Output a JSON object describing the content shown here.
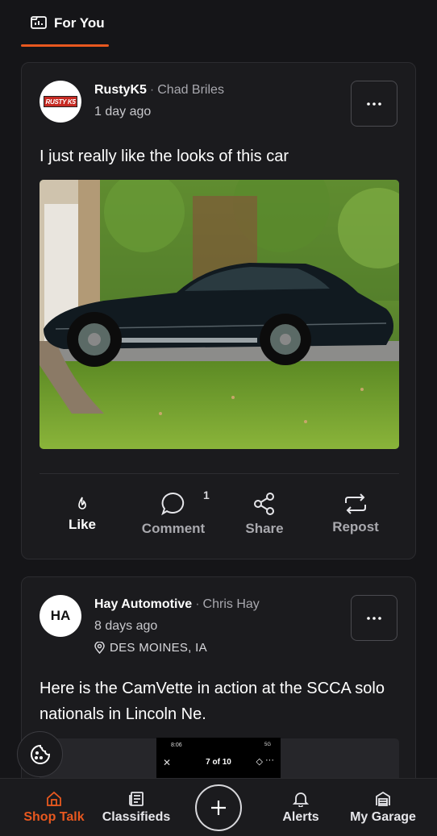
{
  "tabs": {
    "for_you": "For You"
  },
  "posts": [
    {
      "author": "RustyK5",
      "real_name": "Chad Briles",
      "separator": "·",
      "time": "1 day ago",
      "avatar_text": "RUSTY K5",
      "text": "I just really like the looks of this car",
      "comment_count": "1"
    },
    {
      "author": "Hay Automotive",
      "real_name": "Chris Hay",
      "separator": "·",
      "time": "8 days ago",
      "location": "DES MOINES, IA",
      "avatar_initials": "HA",
      "text": "Here is the CamVette in action at the SCCA solo nationals in Lincoln Ne."
    }
  ],
  "actions": {
    "like": "Like",
    "comment": "Comment",
    "share": "Share",
    "repost": "Repost"
  },
  "overlay": {
    "time": "8:06",
    "status": "5G",
    "counter": "7 of 10"
  },
  "nav": {
    "shop_talk": "Shop Talk",
    "classifieds": "Classifieds",
    "alerts": "Alerts",
    "my_garage": "My Garage"
  },
  "colors": {
    "accent": "#e8581f",
    "background": "#151518",
    "card": "#1b1b1e"
  }
}
